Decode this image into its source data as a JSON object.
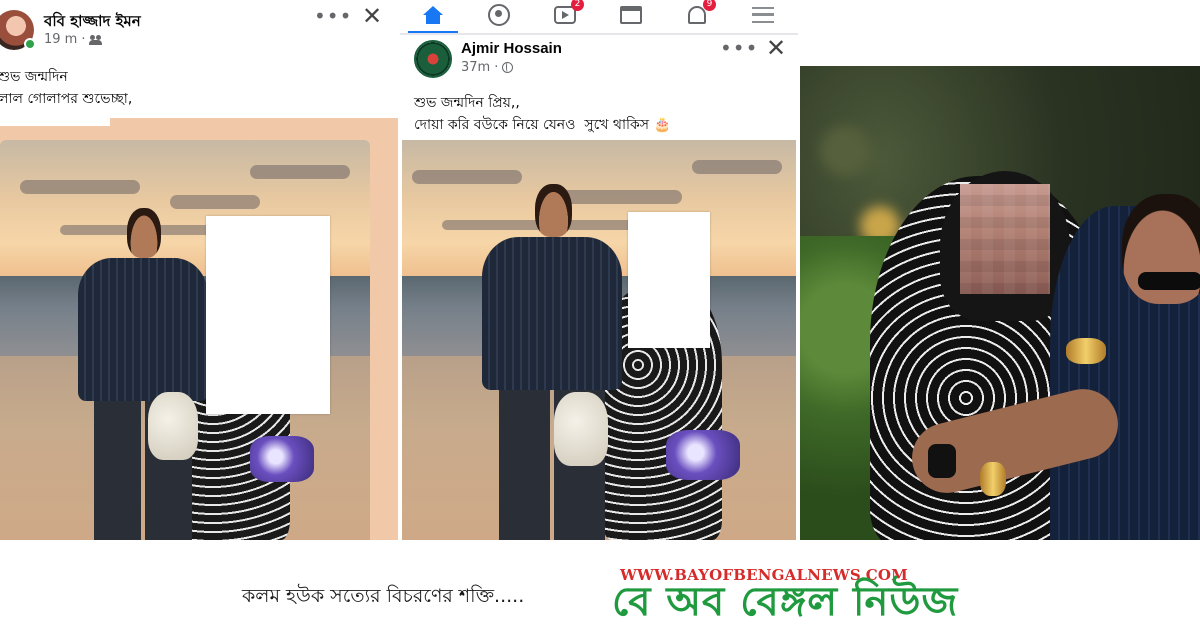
{
  "panel1": {
    "author": "ববি হাজ্জাদ ইমন",
    "time": "19 m",
    "audience_icon": "friends-icon",
    "post_line1": "শুভ জন্মদিন",
    "post_line2": "লাল গোলাপর শুভেচ্ছা,"
  },
  "panel2": {
    "nav": {
      "items": [
        "home-icon",
        "groups-icon",
        "video-icon",
        "marketplace-icon",
        "notifications-icon",
        "menu-icon"
      ],
      "video_badge": "2",
      "notifications_badge": "9",
      "active_color": "#1877f2"
    },
    "author": "Ajmir Hossain",
    "time": "37m",
    "audience_icon": "globe-icon",
    "post_line1": "শুভ জন্মদিন প্রিয়,,",
    "post_line2": "দোয়া করি বউকে নিয়ে যেনও  সুখে থাকিস 🎂"
  },
  "footer": {
    "tagline": "কলম হউক সত্যের বিচরণের শক্তি.....",
    "site_url": "WWW.BAYOFBENGALNEWS.COM",
    "brand": "বে অব বেঙ্গল নিউজ",
    "brand_color": "#1f9a3f",
    "url_color": "#d62b2b"
  }
}
